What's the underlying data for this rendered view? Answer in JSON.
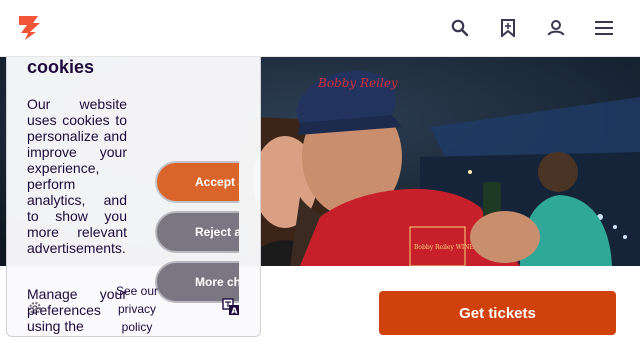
{
  "header": {
    "logo": "eventbrite-logo-icon",
    "icons": [
      "search-icon",
      "bookmark-icon",
      "user-icon",
      "menu-icon"
    ],
    "accent": "#f05537"
  },
  "cookie_banner": {
    "title": "cookies",
    "body": "Our website uses cookies to personalize and improve your experience, perform analytics, and to show you more relevant advertisements.",
    "manage_text": "Manage your preferences using the",
    "privacy_link": "See our privacy policy",
    "accept_label": "Accept a",
    "reject_label": "Reject a",
    "more_label": "More choi"
  },
  "cta": {
    "get_tickets_label": "Get tickets",
    "color": "#d1410c"
  },
  "hero": {
    "cap_text": "Bobby Reiley",
    "apron_text": "Bobby Reiley WINE & FOOD FESTIVAL"
  }
}
